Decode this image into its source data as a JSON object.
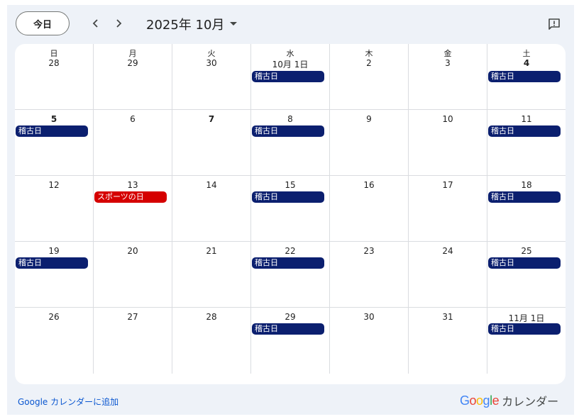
{
  "toolbar": {
    "today_label": "今日",
    "month_label": "2025年 10月"
  },
  "weekdays": [
    "日",
    "月",
    "火",
    "水",
    "木",
    "金",
    "土"
  ],
  "weeks": [
    [
      {
        "label": "28",
        "bold": false,
        "events": []
      },
      {
        "label": "29",
        "bold": false,
        "events": []
      },
      {
        "label": "30",
        "bold": false,
        "events": []
      },
      {
        "label": "10月 1日",
        "bold": false,
        "events": [
          {
            "title": "稽古日",
            "color": "#0b1f6f"
          }
        ]
      },
      {
        "label": "2",
        "bold": false,
        "events": []
      },
      {
        "label": "3",
        "bold": false,
        "events": []
      },
      {
        "label": "4",
        "bold": true,
        "events": [
          {
            "title": "稽古日",
            "color": "#0b1f6f"
          }
        ]
      }
    ],
    [
      {
        "label": "5",
        "bold": true,
        "events": [
          {
            "title": "稽古日",
            "color": "#0b1f6f"
          }
        ]
      },
      {
        "label": "6",
        "bold": false,
        "events": []
      },
      {
        "label": "7",
        "bold": true,
        "events": []
      },
      {
        "label": "8",
        "bold": false,
        "events": [
          {
            "title": "稽古日",
            "color": "#0b1f6f"
          }
        ]
      },
      {
        "label": "9",
        "bold": false,
        "events": []
      },
      {
        "label": "10",
        "bold": false,
        "events": []
      },
      {
        "label": "11",
        "bold": false,
        "events": [
          {
            "title": "稽古日",
            "color": "#0b1f6f"
          }
        ]
      }
    ],
    [
      {
        "label": "12",
        "bold": false,
        "events": []
      },
      {
        "label": "13",
        "bold": false,
        "events": [
          {
            "title": "スポーツの日",
            "color": "#d50000"
          }
        ]
      },
      {
        "label": "14",
        "bold": false,
        "events": []
      },
      {
        "label": "15",
        "bold": false,
        "events": [
          {
            "title": "稽古日",
            "color": "#0b1f6f"
          }
        ]
      },
      {
        "label": "16",
        "bold": false,
        "events": []
      },
      {
        "label": "17",
        "bold": false,
        "events": []
      },
      {
        "label": "18",
        "bold": false,
        "events": [
          {
            "title": "稽古日",
            "color": "#0b1f6f"
          }
        ]
      }
    ],
    [
      {
        "label": "19",
        "bold": false,
        "events": [
          {
            "title": "稽古日",
            "color": "#0b1f6f"
          }
        ]
      },
      {
        "label": "20",
        "bold": false,
        "events": []
      },
      {
        "label": "21",
        "bold": false,
        "events": []
      },
      {
        "label": "22",
        "bold": false,
        "events": [
          {
            "title": "稽古日",
            "color": "#0b1f6f"
          }
        ]
      },
      {
        "label": "23",
        "bold": false,
        "events": []
      },
      {
        "label": "24",
        "bold": false,
        "events": []
      },
      {
        "label": "25",
        "bold": false,
        "events": [
          {
            "title": "稽古日",
            "color": "#0b1f6f"
          }
        ]
      }
    ],
    [
      {
        "label": "26",
        "bold": false,
        "events": []
      },
      {
        "label": "27",
        "bold": false,
        "events": []
      },
      {
        "label": "28",
        "bold": false,
        "events": []
      },
      {
        "label": "29",
        "bold": false,
        "events": [
          {
            "title": "稽古日",
            "color": "#0b1f6f"
          }
        ]
      },
      {
        "label": "30",
        "bold": false,
        "events": []
      },
      {
        "label": "31",
        "bold": false,
        "events": []
      },
      {
        "label": "11月 1日",
        "bold": false,
        "events": [
          {
            "title": "稽古日",
            "color": "#0b1f6f"
          }
        ]
      }
    ]
  ],
  "footer": {
    "add_link": "Google カレンダーに追加",
    "brand_google": [
      "G",
      "o",
      "o",
      "g",
      "l",
      "e"
    ],
    "brand_google_colors": [
      "#4285f4",
      "#ea4335",
      "#fbbc05",
      "#4285f4",
      "#34a853",
      "#ea4335"
    ],
    "brand_label": "カレンダー"
  },
  "icons": {
    "prev": "chevron-left-icon",
    "next": "chevron-right-icon",
    "dropdown": "caret-down-icon",
    "feedback": "feedback-icon"
  }
}
